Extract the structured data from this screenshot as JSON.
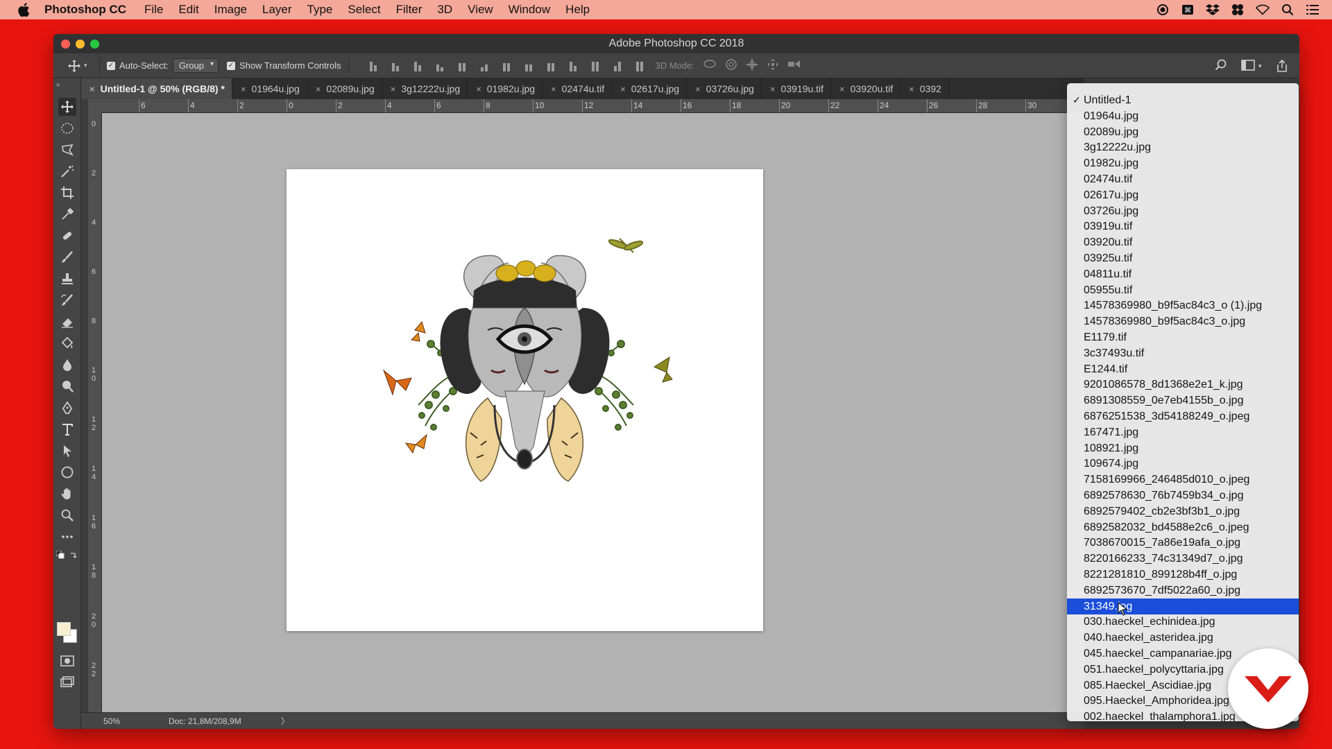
{
  "menubar": {
    "apple_icon": "apple-icon",
    "app_name": "Photoshop CC",
    "items": [
      "File",
      "Edit",
      "Image",
      "Layer",
      "Type",
      "Select",
      "Filter",
      "3D",
      "View",
      "Window",
      "Help"
    ],
    "status_icons": [
      "record-icon",
      "keyboard-icon",
      "dropbox-icon",
      "app-switcher-icon",
      "wifi-icon",
      "search-icon",
      "list-icon"
    ]
  },
  "window": {
    "title": "Adobe Photoshop CC 2018",
    "traffic_colors": [
      "#fc5f57",
      "#fdbc2e",
      "#28c840"
    ]
  },
  "options": {
    "auto_select_label": "Auto-Select:",
    "auto_select_value": "Group",
    "show_transform_label": "Show Transform Controls",
    "mode_3d_label": "3D Mode:"
  },
  "tabs": [
    {
      "label": "Untitled-1 @ 50% (RGB/8) *",
      "active": true
    },
    {
      "label": "01964u.jpg"
    },
    {
      "label": "02089u.jpg"
    },
    {
      "label": "3g12222u.jpg"
    },
    {
      "label": "01982u.jpg"
    },
    {
      "label": "02474u.tif"
    },
    {
      "label": "02617u.jpg"
    },
    {
      "label": "03726u.jpg"
    },
    {
      "label": "03919u.tif"
    },
    {
      "label": "03920u.tif"
    },
    {
      "label": "0392"
    }
  ],
  "tab_overflow": ">>",
  "tools": [
    "move-tool-icon",
    "marquee-tool-icon",
    "lasso-tool-icon",
    "magic-wand-tool-icon",
    "crop-tool-icon",
    "eyedropper-tool-icon",
    "healing-brush-tool-icon",
    "brush-tool-icon",
    "clone-stamp-tool-icon",
    "history-brush-tool-icon",
    "eraser-tool-icon",
    "paint-bucket-tool-icon",
    "blur-tool-icon",
    "dodge-tool-icon",
    "pen-tool-icon",
    "type-tool-icon",
    "path-selection-tool-icon",
    "ellipse-tool-icon",
    "hand-tool-icon",
    "zoom-tool-icon",
    "more-tools-icon"
  ],
  "ruler": {
    "h_labels": [
      "6",
      "4",
      "2",
      "0",
      "2",
      "4",
      "6",
      "8",
      "10",
      "12",
      "14",
      "16",
      "18",
      "20",
      "22",
      "24",
      "26",
      "28",
      "30"
    ],
    "v_labels": [
      "0",
      "2",
      "4",
      "6",
      "8",
      "10",
      "12",
      "14",
      "16",
      "18",
      "20",
      "22"
    ]
  },
  "status": {
    "zoom": "50%",
    "doc_size": "Doc: 21,8M/208,9M",
    "arrow": "〉"
  },
  "documents_menu": {
    "checked_item": "Untitled-1",
    "selected_item": "31349.jpg",
    "items": [
      "Untitled-1",
      "01964u.jpg",
      "02089u.jpg",
      "3g12222u.jpg",
      "01982u.jpg",
      "02474u.tif",
      "02617u.jpg",
      "03726u.jpg",
      "03919u.tif",
      "03920u.tif",
      "03925u.tif",
      "04811u.tif",
      "05955u.tif",
      "14578369980_b9f5ac84c3_o (1).jpg",
      "14578369980_b9f5ac84c3_o.jpg",
      "E1179.tif",
      "3c37493u.tif",
      "E1244.tif",
      "9201086578_8d1368e2e1_k.jpg",
      "6891308559_0e7eb4155b_o.jpg",
      "6876251538_3d54188249_o.jpeg",
      "167471.jpg",
      "108921.jpg",
      "109674.jpg",
      "7158169966_246485d010_o.jpeg",
      "6892578630_76b7459b34_o.jpg",
      "6892579402_cb2e3bf3b1_o.jpg",
      "6892582032_bd4588e2c6_o.jpeg",
      "7038670015_7a86e19afa_o.jpg",
      "8220166233_74c31349d7_o.jpg",
      "8221281810_899128b4ff_o.jpg",
      "6892573670_7df5022a60_o.jpg",
      "31349.jpg",
      "030.haeckel_echinidea.jpg",
      "040.haeckel_asteridea.jpg",
      "045.haeckel_campanariae.jpg",
      "051.haeckel_polycyttaria.jpg",
      "085.Haeckel_Ascidiae.jpg",
      "095.Haeckel_Amphoridea.jpg",
      "002.haeckel_thalamphora1.jpg"
    ]
  },
  "colors": {
    "desktop": "#e8140e",
    "selection": "#1b4fda",
    "badge_logo": "#d91e18",
    "foreground_swatch": "#f7efcf",
    "background_swatch": "#ffffff"
  },
  "badge": "logo-badge-icon"
}
